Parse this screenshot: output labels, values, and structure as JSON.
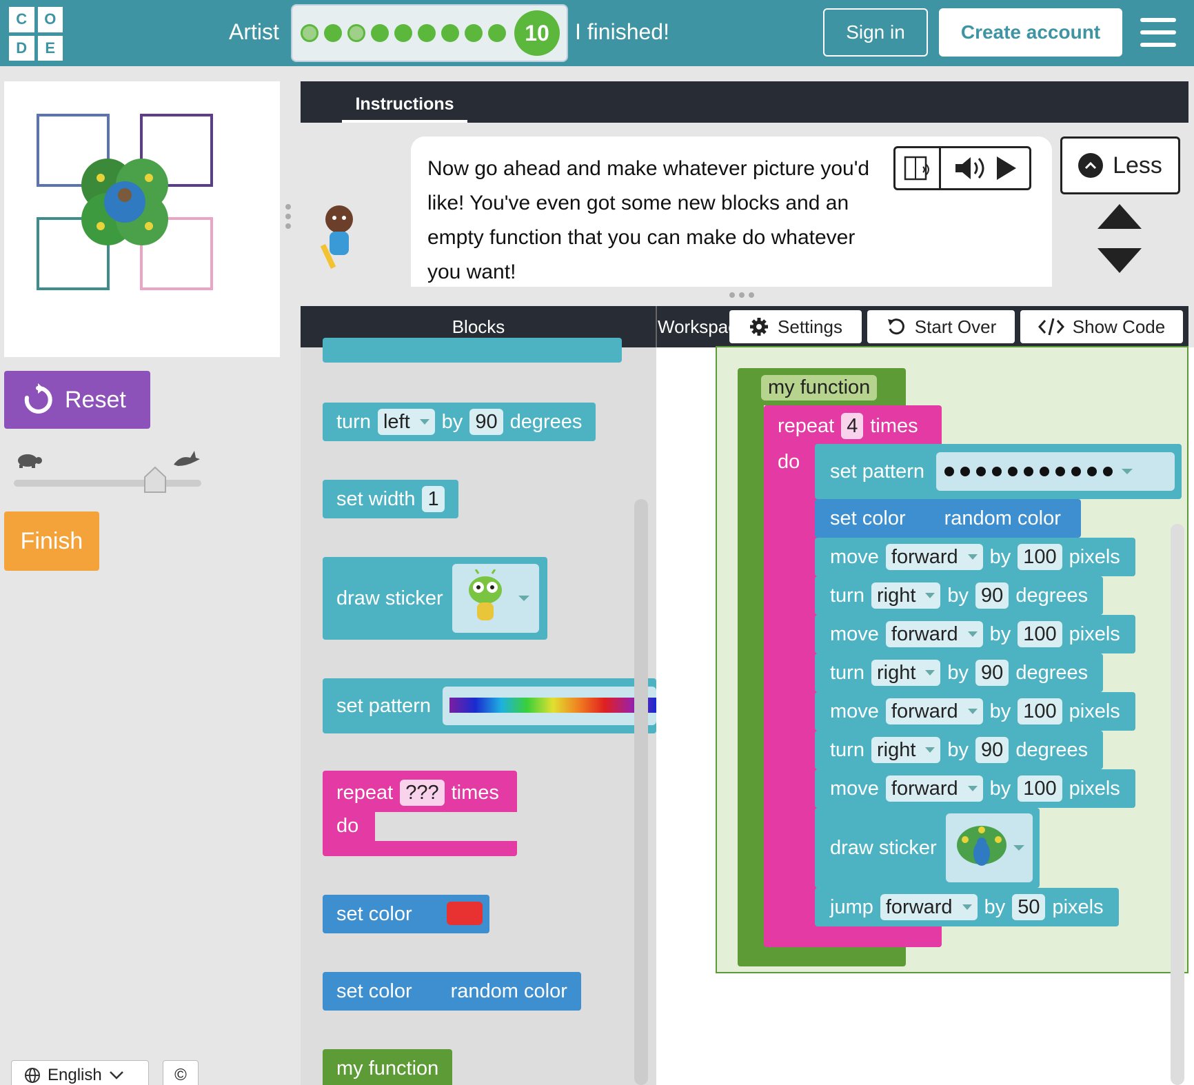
{
  "header": {
    "logo_letters": [
      "C",
      "O",
      "D",
      "E"
    ],
    "level_title": "Artist",
    "current_level": "10",
    "finished_label": "I finished!",
    "sign_in": "Sign in",
    "create_account": "Create account"
  },
  "left": {
    "reset_label": "Reset",
    "finish_label": "Finish",
    "language": "English",
    "copyright_symbol": "©"
  },
  "instructions": {
    "tab_label": "Instructions",
    "text": "Now go ahead and make whatever picture you'd like! You've even got some new blocks and an empty function that you can make do whatever you want!",
    "less_label": "Less"
  },
  "editor": {
    "blocks_header": "Blocks",
    "workspace_header": "Workspace",
    "settings": "Settings",
    "start_over": "Start Over",
    "show_code": "Show Code"
  },
  "toolbox": {
    "turn_left": {
      "turn": "turn",
      "dir": "left",
      "by": "by",
      "val": "90",
      "unit": "degrees"
    },
    "set_width": {
      "label": "set width",
      "val": "1"
    },
    "draw_sticker": {
      "label": "draw sticker"
    },
    "set_pattern": {
      "label": "set pattern"
    },
    "repeat": {
      "label": "repeat",
      "val": "???",
      "times": "times",
      "do": "do"
    },
    "set_color": {
      "label": "set color"
    },
    "set_color_random": {
      "label": "set color",
      "val": "random color"
    },
    "my_function": {
      "label": "my function"
    }
  },
  "workspace": {
    "fn_name": "my function",
    "repeat": {
      "label": "repeat",
      "val": "4",
      "times": "times",
      "do": "do"
    },
    "set_pattern": {
      "label": "set pattern"
    },
    "set_color": {
      "label": "set color",
      "val": "random color"
    },
    "move": {
      "label": "move",
      "dir": "forward",
      "by": "by",
      "val": "100",
      "unit": "pixels"
    },
    "turn": {
      "label": "turn",
      "dir": "right",
      "by": "by",
      "val": "90",
      "unit": "degrees"
    },
    "draw_sticker": {
      "label": "draw sticker"
    },
    "jump": {
      "label": "jump",
      "dir": "forward",
      "by": "by",
      "val": "50",
      "unit": "pixels"
    }
  },
  "colors": {
    "header": "#3e94a3",
    "reset": "#8c52ba",
    "finish": "#f4a23a",
    "progress_green": "#5cb73d",
    "block_teal": "#4db3c3",
    "block_blue": "#3d8fd0",
    "block_pink": "#e43aa3",
    "block_green": "#5c9b35"
  }
}
